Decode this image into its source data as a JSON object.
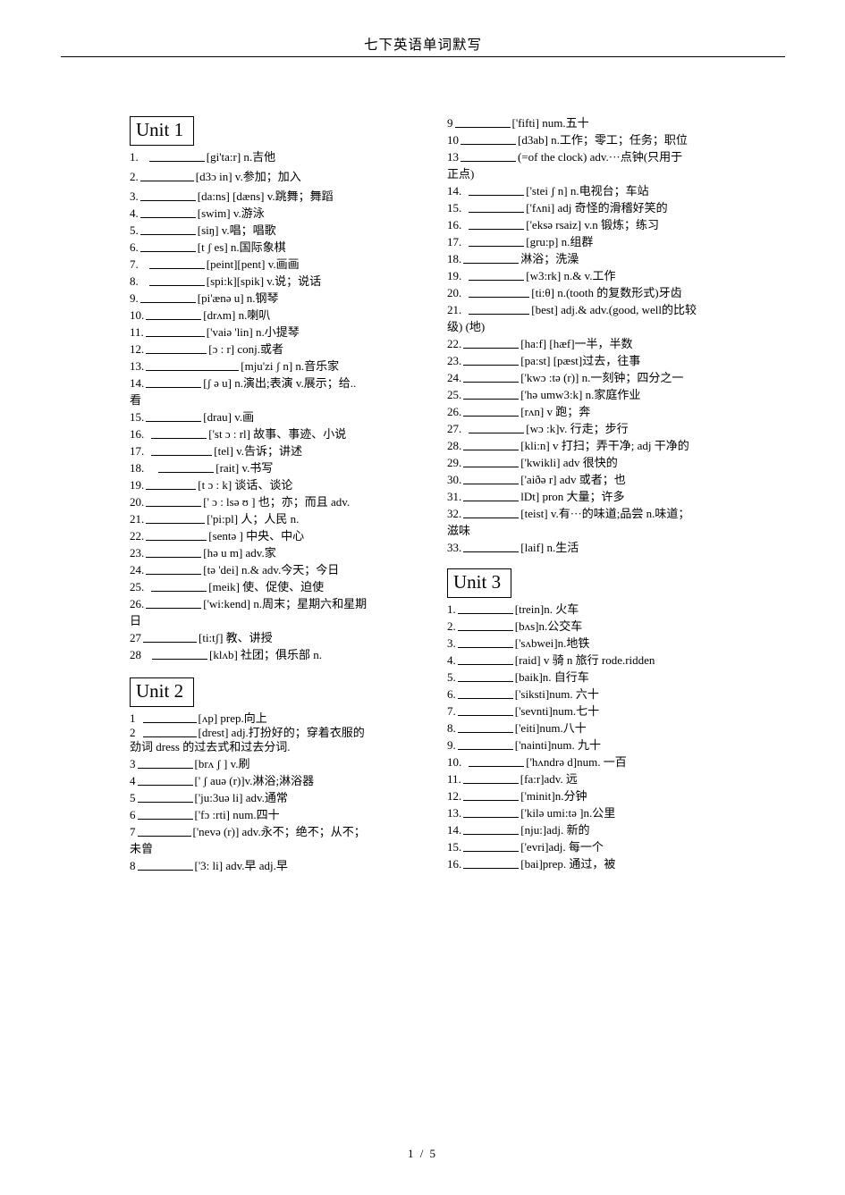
{
  "header": {
    "title": "七下英语单词默写"
  },
  "footer": {
    "page_indicator": "1 / 5"
  },
  "units": {
    "unit1_label": "Unit  1",
    "unit2_label": "Unit  2",
    "unit3_label": "Unit  3"
  },
  "left_column": {
    "unit1_entries": [
      {
        "num": "1.",
        "blank_width": 62,
        "gap_before_blank": 10,
        "gloss": "[gi'ta:r] n.吉他",
        "spacing": "normal"
      },
      {
        "num": "2.",
        "blank_width": 60,
        "gap_before_blank": 0,
        "gloss": "[d3ɔ in]   v.参加；加入",
        "spacing": "normal"
      },
      {
        "num": "3.",
        "blank_width": 62,
        "gap_before_blank": 0,
        "gloss": "[da:ns] [dæns] v.跳舞；舞蹈",
        "spacing": "tight"
      },
      {
        "num": "4.",
        "blank_width": 62,
        "gap_before_blank": 0,
        "gloss": "[swim]   v.游泳",
        "spacing": "tight"
      },
      {
        "num": "5.",
        "blank_width": 62,
        "gap_before_blank": 0,
        "gloss": "[siŋ]    v.唱；唱歌",
        "spacing": "tight"
      },
      {
        "num": "6.",
        "blank_width": 62,
        "gap_before_blank": 0,
        "gloss": "[t ʃ es] n.国际象棋",
        "spacing": "tight"
      },
      {
        "num": "7.",
        "blank_width": 62,
        "gap_before_blank": 10,
        "gloss": "[peint][pent] v.画画",
        "spacing": "tight"
      },
      {
        "num": "8.",
        "blank_width": 62,
        "gap_before_blank": 10,
        "gloss": "[spi:k][spik] v.说；说话",
        "spacing": "tight"
      },
      {
        "num": "9.",
        "blank_width": 62,
        "gap_before_blank": 0,
        "gloss": "[pi'ænə u] n.钢琴",
        "spacing": "tight"
      },
      {
        "num": "10.",
        "blank_width": 62,
        "gap_before_blank": 0,
        "gloss": "[drʌm] n.喇叭",
        "spacing": "tight"
      },
      {
        "num": "11.",
        "blank_width": 66,
        "gap_before_blank": 0,
        "gloss": "['vaiə 'lin] n.小提琴",
        "spacing": "tight"
      },
      {
        "num": "12.",
        "blank_width": 68,
        "gap_before_blank": 0,
        "gloss": "[ɔ : r]     conj.或者",
        "spacing": "tight"
      },
      {
        "num": "13.",
        "blank_width": 104,
        "gap_before_blank": 0,
        "gloss": "[mju'zi ʃ n]   n.音乐家",
        "spacing": "tight"
      },
      {
        "num": "14.",
        "blank_width": 62,
        "gap_before_blank": 0,
        "gloss": "[ʃ ə u]   n.演出;表演 v.展示；给..",
        "wrap": "看",
        "spacing": "tight"
      },
      {
        "num": "15.",
        "blank_width": 62,
        "gap_before_blank": 0,
        "gloss": "[drau]     v.画",
        "spacing": "tight"
      },
      {
        "num": "16.",
        "blank_width": 62,
        "gap_before_blank": 6,
        "gloss": "['st ɔ : rl]  故事、事迹、小说",
        "spacing": "tight"
      },
      {
        "num": "17.",
        "blank_width": 68,
        "gap_before_blank": 6,
        "gloss": "[tel]   v.告诉；讲述",
        "spacing": "tight"
      },
      {
        "num": "18.",
        "blank_width": 62,
        "gap_before_blank": 14,
        "gloss": "[rait] v.书写",
        "spacing": "tight"
      },
      {
        "num": "19.",
        "blank_width": 56,
        "gap_before_blank": 0,
        "gloss": "[t ɔ : k]    谈话、谈论",
        "spacing": "tight"
      },
      {
        "num": "20.",
        "blank_width": 62,
        "gap_before_blank": 0,
        "gloss": "[' ɔ : lsə ʊ ]   也；亦；而且 adv.",
        "spacing": "tight"
      },
      {
        "num": "21.",
        "blank_width": 66,
        "gap_before_blank": 0,
        "gloss": "['pi:pl]   人；人民 n.",
        "spacing": "tight"
      },
      {
        "num": "22.",
        "blank_width": 68,
        "gap_before_blank": 0,
        "gloss": "[sentə ]   中央、中心",
        "spacing": "tight"
      },
      {
        "num": "23.",
        "blank_width": 62,
        "gap_before_blank": 0,
        "gloss": "[hə  u m]    adv.家",
        "spacing": "tight"
      },
      {
        "num": "24.",
        "blank_width": 62,
        "gap_before_blank": 0,
        "gloss": "[tə 'dei]   n.& adv.今天；今日",
        "spacing": "tight"
      },
      {
        "num": "25.",
        "blank_width": 62,
        "gap_before_blank": 6,
        "gloss": "[meik]  使、促使、迫使",
        "spacing": "tight"
      },
      {
        "num": "26.",
        "blank_width": 62,
        "gap_before_blank": 0,
        "gloss": "['wi:kend]   n.周末；星期六和星期",
        "wrap": "日",
        "spacing": "tight"
      },
      {
        "num": "27",
        "blank_width": 60,
        "gap_before_blank": 0,
        "gloss": "[ti:tʃ]    教、讲授",
        "spacing": "tight"
      },
      {
        "num": "28",
        "blank_width": 62,
        "gap_before_blank": 10,
        "gloss": "[klʌb]   社团；俱乐部 n.",
        "spacing": "tight"
      }
    ],
    "unit2_entries": [
      {
        "num": "1",
        "blank_width": 60,
        "gap_before_blank": 6,
        "gloss": "[ʌp] prep.向上",
        "spacing": "vtight"
      },
      {
        "num": "2",
        "blank_width": 60,
        "gap_before_blank": 6,
        "gloss": "[drest] adj.打扮好的；穿着衣服的",
        "wrap": "劲词 dress 的过去式和过去分词.",
        "spacing": "vtight"
      },
      {
        "num": "3",
        "blank_width": 62,
        "gap_before_blank": 0,
        "gloss": "[brʌ  ʃ ]   v.刷",
        "spacing": "tight"
      },
      {
        "num": "4",
        "blank_width": 62,
        "gap_before_blank": 0,
        "gloss": "[' ʃ auə (r)]v.淋浴;淋浴器",
        "spacing": "tight"
      },
      {
        "num": "5",
        "blank_width": 62,
        "gap_before_blank": 0,
        "gloss": "['ju:3uə li] adv.通常",
        "spacing": "tight"
      },
      {
        "num": "6",
        "blank_width": 62,
        "gap_before_blank": 0,
        "gloss": "['fɔ :rti] num.四十",
        "spacing": "tight"
      },
      {
        "num": "7",
        "blank_width": 60,
        "gap_before_blank": 0,
        "gloss": "['nevə (r)]  adv.永不；绝不；从不；",
        "wrap": "未曾",
        "spacing": "tight"
      },
      {
        "num": "8",
        "blank_width": 62,
        "gap_before_blank": 0,
        "gloss": "['3: li] adv.早 adj.早",
        "spacing": "tight"
      }
    ]
  },
  "right_column": {
    "unit2_entries": [
      {
        "num": "9",
        "blank_width": 62,
        "gap_before_blank": 0,
        "gloss": "['fifti]   num.五十",
        "spacing": "tight"
      },
      {
        "num": "10",
        "blank_width": 62,
        "gap_before_blank": 0,
        "gloss": "[d3ab]  n.工作；零工；任务；职位",
        "spacing": "tight"
      },
      {
        "num": "13",
        "blank_width": 62,
        "gap_before_blank": 0,
        "gloss": "(=of the clock)   adv.···点钟(只用于",
        "wrap": "正点)",
        "spacing": "tight"
      },
      {
        "num": "14.",
        "blank_width": 62,
        "gap_before_blank": 6,
        "gloss": "['stei ʃ n] n.电视台；车站",
        "spacing": "tight"
      },
      {
        "num": "15.",
        "blank_width": 62,
        "gap_before_blank": 6,
        "gloss": "['fʌni] adj 奇怪的滑稽好笑的",
        "spacing": "tight"
      },
      {
        "num": "16.",
        "blank_width": 62,
        "gap_before_blank": 6,
        "gloss": "['eksə rsaiz] v.n 锻炼；练习",
        "spacing": "tight"
      },
      {
        "num": "17.",
        "blank_width": 62,
        "gap_before_blank": 6,
        "gloss": "[gru:p] n.组群",
        "spacing": "tight"
      },
      {
        "num": "18.",
        "blank_width": 62,
        "gap_before_blank": 0,
        "gloss": "淋浴；洗澡",
        "spacing": "tight"
      },
      {
        "num": "19.",
        "blank_width": 62,
        "gap_before_blank": 6,
        "gloss": "[w3:rk] n.& v.工作",
        "spacing": "tight"
      },
      {
        "num": "20.",
        "blank_width": 68,
        "gap_before_blank": 6,
        "gloss": "[ti:θ] n.(tooth 的复数形式)牙齿",
        "spacing": "tight"
      },
      {
        "num": "21.",
        "blank_width": 68,
        "gap_before_blank": 6,
        "gloss": "[best] adj.& adv.(good, well的比较",
        "wrap": "级) (地)",
        "spacing": "tight"
      },
      {
        "num": "22.",
        "blank_width": 62,
        "gap_before_blank": 0,
        "gloss": "[ha:f] [hæf]一半，半数",
        "spacing": "tight"
      },
      {
        "num": "23.",
        "blank_width": 62,
        "gap_before_blank": 0,
        "gloss": "[pa:st] [pæst]过去，往事",
        "spacing": "tight"
      },
      {
        "num": "24.",
        "blank_width": 62,
        "gap_before_blank": 0,
        "gloss": "['kwɔ :tə (r)] n.一刻钟；四分之一",
        "spacing": "tight"
      },
      {
        "num": "25.",
        "blank_width": 62,
        "gap_before_blank": 0,
        "gloss": "['hə umw3:k] n.家庭作业",
        "spacing": "tight"
      },
      {
        "num": "26.",
        "blank_width": 62,
        "gap_before_blank": 0,
        "gloss": "[rʌn] v  跑；奔",
        "spacing": "tight"
      },
      {
        "num": "27.",
        "blank_width": 62,
        "gap_before_blank": 6,
        "gloss": "[wɔ :k]v. 行走；步行",
        "spacing": "tight"
      },
      {
        "num": "28.",
        "blank_width": 62,
        "gap_before_blank": 0,
        "gloss": "[kli:n] v 打扫；弄干净; adj 干净的",
        "spacing": "tight"
      },
      {
        "num": "29.",
        "blank_width": 62,
        "gap_before_blank": 0,
        "gloss": "['kwikli] adv 很快的",
        "spacing": "tight"
      },
      {
        "num": "30.",
        "blank_width": 62,
        "gap_before_blank": 0,
        "gloss": "['aiðə r] adv 或者；也",
        "spacing": "tight"
      },
      {
        "num": "31.",
        "blank_width": 62,
        "gap_before_blank": 0,
        "gloss": "lDt] pron 大量；许多",
        "spacing": "tight"
      },
      {
        "num": "32.",
        "blank_width": 62,
        "gap_before_blank": 0,
        "gloss": "[teist] v.有···的味道;品尝 n.味道；",
        "wrap": "滋味",
        "spacing": "tight"
      },
      {
        "num": "33.",
        "blank_width": 62,
        "gap_before_blank": 0,
        "gloss": "[laif] n.生活",
        "spacing": "tight"
      }
    ],
    "unit3_entries": [
      {
        "num": "1.",
        "blank_width": 62,
        "gap_before_blank": 0,
        "gloss": "[trein]n.  火车",
        "spacing": "tight"
      },
      {
        "num": "2.",
        "blank_width": 62,
        "gap_before_blank": 0,
        "gloss": "[bʌs]n.公交车",
        "spacing": "tight"
      },
      {
        "num": "3.",
        "blank_width": 62,
        "gap_before_blank": 0,
        "gloss": "['sʌbwei]n.地铁",
        "spacing": "tight"
      },
      {
        "num": "4.",
        "blank_width": 62,
        "gap_before_blank": 0,
        "gloss": "[raid] v 骑 n 旅行 rode.ridden",
        "spacing": "tight"
      },
      {
        "num": "5.",
        "blank_width": 62,
        "gap_before_blank": 0,
        "gloss": "[baik]n.  自行车",
        "spacing": "tight"
      },
      {
        "num": "6.",
        "blank_width": 62,
        "gap_before_blank": 0,
        "gloss": "['siksti]num.  六十",
        "spacing": "tight"
      },
      {
        "num": "7.",
        "blank_width": 62,
        "gap_before_blank": 0,
        "gloss": "['sevnti]num.七十",
        "spacing": "tight"
      },
      {
        "num": "8.",
        "blank_width": 62,
        "gap_before_blank": 0,
        "gloss": "['eiti]num.八十",
        "spacing": "tight"
      },
      {
        "num": "9.",
        "blank_width": 62,
        "gap_before_blank": 0,
        "gloss": "['nainti]num.  九十",
        "spacing": "tight"
      },
      {
        "num": "10.",
        "blank_width": 62,
        "gap_before_blank": 6,
        "gloss": "['hʌndrə d]num.  一百",
        "spacing": "tight"
      },
      {
        "num": "11.",
        "blank_width": 62,
        "gap_before_blank": 0,
        "gloss": "[fa:r]adv.  远",
        "spacing": "tight"
      },
      {
        "num": "12.",
        "blank_width": 62,
        "gap_before_blank": 0,
        "gloss": "['minit]n.分钟",
        "spacing": "tight"
      },
      {
        "num": "13.",
        "blank_width": 62,
        "gap_before_blank": 0,
        "gloss": "['kilə umi:tə ]n.公里",
        "spacing": "tight"
      },
      {
        "num": "14.",
        "blank_width": 62,
        "gap_before_blank": 0,
        "gloss": "[nju:]adj.  新的",
        "spacing": "tight"
      },
      {
        "num": "15.",
        "blank_width": 62,
        "gap_before_blank": 0,
        "gloss": "['evri]adj.  每一个",
        "spacing": "tight"
      },
      {
        "num": "16.",
        "blank_width": 62,
        "gap_before_blank": 0,
        "gloss": "[bai]prep.  通过，被",
        "spacing": "tight"
      }
    ]
  }
}
